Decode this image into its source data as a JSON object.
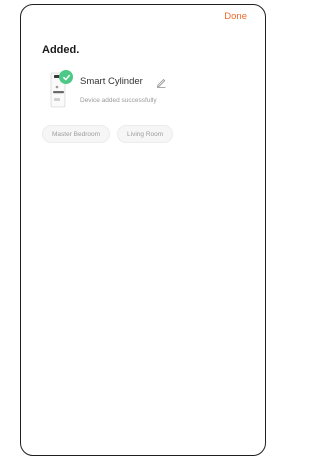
{
  "header": {
    "done_label": "Done",
    "accent": "#ef6a2a"
  },
  "page": {
    "title": "Added."
  },
  "device": {
    "name": "Smart Cylinder",
    "status": "Device added successfully",
    "check_color": "#4cc986",
    "icon": "smart-lock-device-icon"
  },
  "rooms": [
    {
      "label": "Master Bedroom"
    },
    {
      "label": "Living Room"
    }
  ]
}
